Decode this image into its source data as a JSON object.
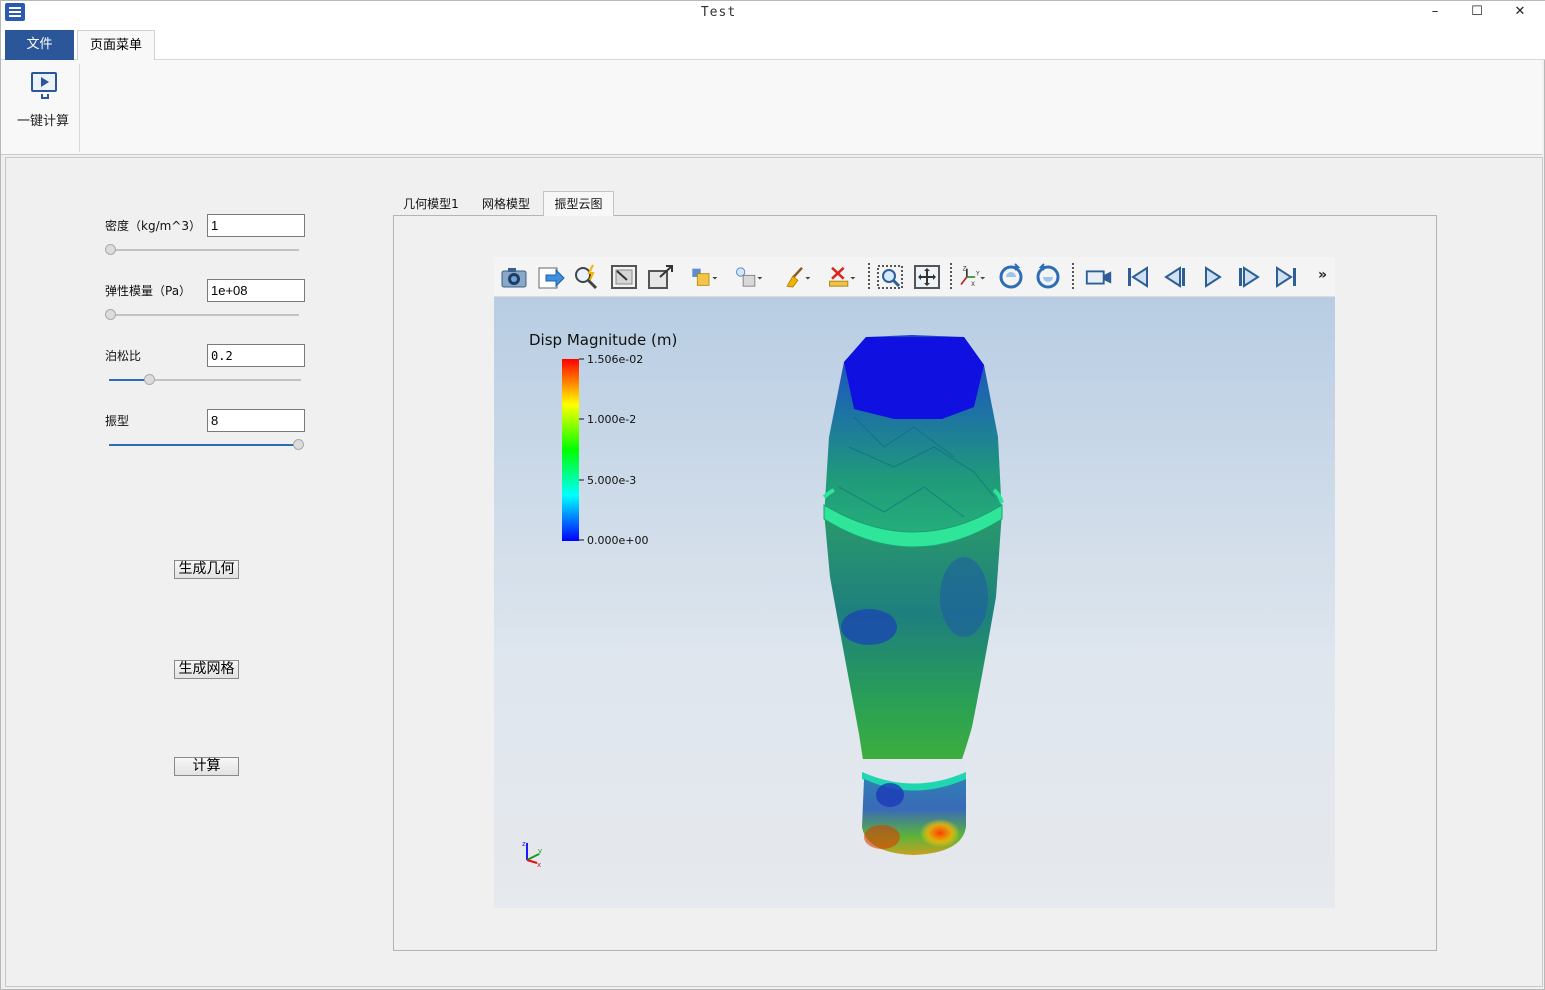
{
  "window": {
    "title": "Test",
    "minimize": "–",
    "maximize": "☐",
    "close": "✕"
  },
  "menu": {
    "file": "文件",
    "page_menu": "页面菜单"
  },
  "ribbon": {
    "one_click_compute": "一键计算"
  },
  "params": {
    "density": {
      "label": "密度（kg/m^3）",
      "value": "1",
      "slider_fraction": 0.0
    },
    "elastic_modulus": {
      "label": "弹性模量（Pa）",
      "value": "1e+08",
      "slider_fraction": 0.0
    },
    "poisson_ratio": {
      "label": "泊松比",
      "value": "0.2",
      "slider_fraction": 0.2
    },
    "mode_shape": {
      "label": "振型",
      "value": "8",
      "slider_fraction": 1.0
    }
  },
  "actions": {
    "generate_geometry": "生成几何",
    "generate_mesh": "生成网格",
    "compute": "计算"
  },
  "tabs": [
    {
      "label": "几何模型1",
      "active": false
    },
    {
      "label": "网格模型",
      "active": false
    },
    {
      "label": "振型云图",
      "active": true
    }
  ],
  "toolbar_icons": [
    "camera-icon",
    "export-icon",
    "probe-icon",
    "zoom-data-icon",
    "zoom-box-icon",
    "representation-icon",
    "lighting-icon",
    "clear-icon",
    "delete-ruler-icon",
    "select-points-icon",
    "reset-camera-icon",
    "orientation-axes-icon",
    "rotate-ccw-icon",
    "rotate-cw-icon",
    "record-icon",
    "first-frame-icon",
    "previous-frame-icon",
    "play-icon",
    "next-frame-icon",
    "last-frame-icon",
    "more-icon"
  ],
  "toolbar_more": "»",
  "colorbar": {
    "title": "Disp Magnitude (m)",
    "ticks": [
      "1.506e-02",
      "1.000e-2",
      "5.000e-3",
      "0.000e+00"
    ],
    "colors": [
      "#ff0000",
      "#ffff00",
      "#00ff00",
      "#00ffff",
      "#0000ff"
    ]
  },
  "axes_widget": {
    "x": "x",
    "y": "y",
    "z": "z"
  }
}
